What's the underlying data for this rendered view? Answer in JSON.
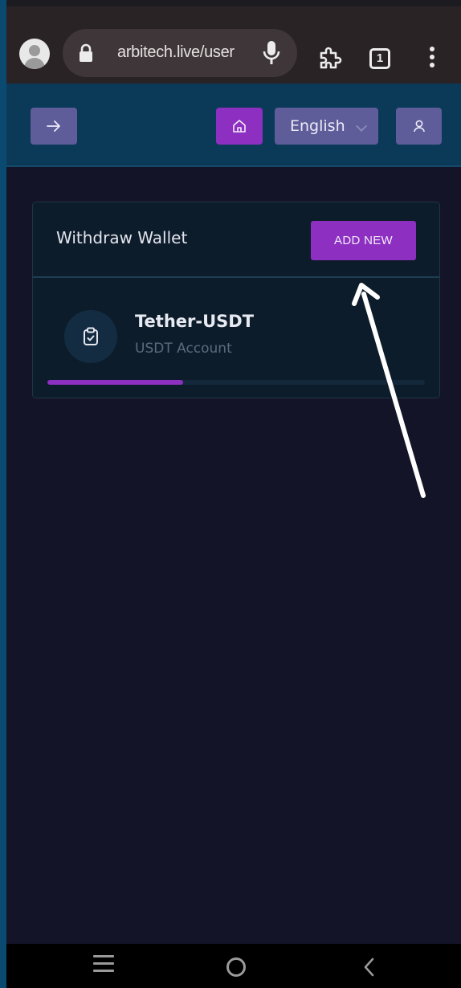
{
  "browser": {
    "url": "arbitech.live/user",
    "tab_count": "1",
    "icons": [
      "account-circle-icon",
      "lock-icon",
      "mic-icon",
      "extensions-icon",
      "tab-switcher-icon",
      "more-menu-icon"
    ]
  },
  "header": {
    "language": "English",
    "icons": [
      "arrow-right-icon",
      "home-icon",
      "user-icon"
    ],
    "colors": {
      "accent": "#8d2fc0",
      "button": "#5e5c99",
      "bar": "#0b3a58"
    }
  },
  "withdraw_wallet": {
    "title": "Withdraw Wallet",
    "add_button": "ADD NEW",
    "wallets": [
      {
        "name": "Tether-USDT",
        "account_type": "USDT Account",
        "icon": "clipboard-check-icon",
        "progress_fraction": 0.36
      }
    ]
  },
  "system_nav": {
    "icons": [
      "recent-apps-icon",
      "home-circle-icon",
      "back-chevron-icon"
    ]
  }
}
